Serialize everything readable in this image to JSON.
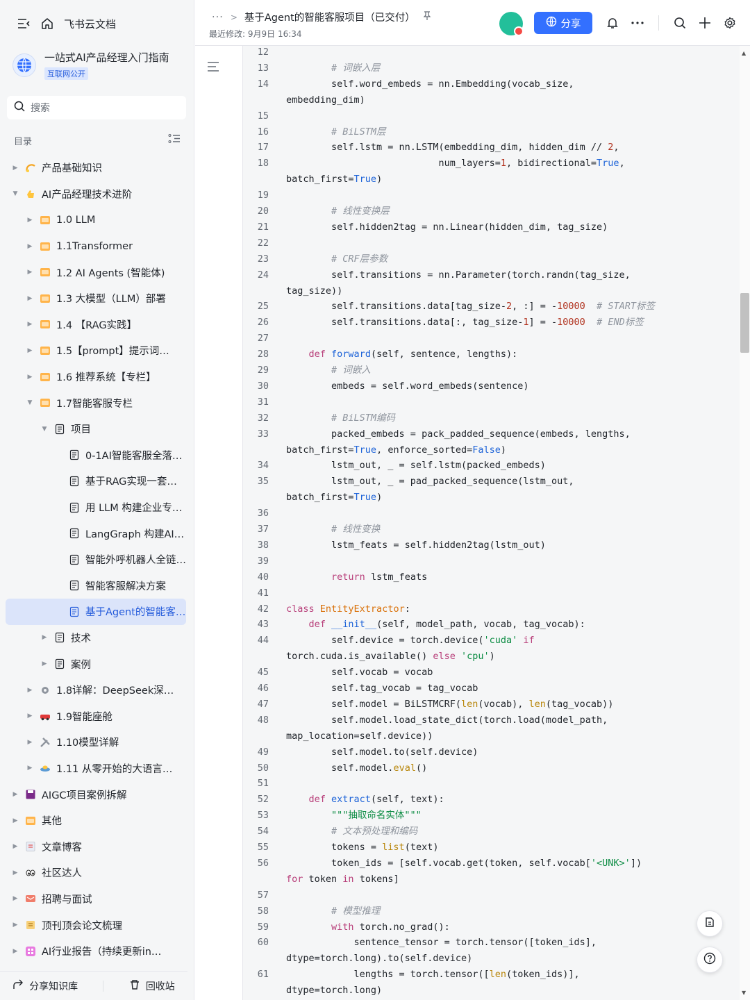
{
  "sidebar": {
    "home_label": "飞书云文档",
    "space_title": "一站式AI产品经理入门指南",
    "space_badge": "互联网公开",
    "search_placeholder": "搜索",
    "toc_label": "目录",
    "tree": [
      {
        "label": "产品基础知识",
        "level": 0,
        "caret": "right",
        "icon": "sun-icon"
      },
      {
        "label": "AI产品经理技术进阶",
        "level": 0,
        "caret": "down",
        "icon": "hand-icon"
      },
      {
        "label": "1.0 LLM",
        "level": 1,
        "caret": "right",
        "icon": "folder-orange-icon"
      },
      {
        "label": "1.1Transformer",
        "level": 1,
        "caret": "right",
        "icon": "folder-orange-icon"
      },
      {
        "label": "1.2 AI Agents (智能体)",
        "level": 1,
        "caret": "right",
        "icon": "folder-orange-icon"
      },
      {
        "label": "1.3 大模型（LLM）部署",
        "level": 1,
        "caret": "right",
        "icon": "folder-orange-icon"
      },
      {
        "label": "1.4 【RAG实践】",
        "level": 1,
        "caret": "right",
        "icon": "folder-orange-icon"
      },
      {
        "label": "1.5【prompt】提示词工程",
        "level": 1,
        "caret": "right",
        "icon": "folder-orange-icon"
      },
      {
        "label": "1.6 推荐系统【专栏】",
        "level": 1,
        "caret": "right",
        "icon": "folder-orange-icon"
      },
      {
        "label": "1.7智能客服专栏",
        "level": 1,
        "caret": "down",
        "icon": "folder-orange-icon"
      },
      {
        "label": "项目",
        "level": 2,
        "caret": "down",
        "icon": "doc-icon"
      },
      {
        "label": "0-1AI智能客服全落地实战",
        "level": 3,
        "caret": "none",
        "icon": "doc-icon"
      },
      {
        "label": "基于RAG实现一套企业级知识库",
        "level": 3,
        "caret": "none",
        "icon": "doc-icon"
      },
      {
        "label": "用 LLM 构建企业专属客服",
        "level": 3,
        "caret": "none",
        "icon": "doc-icon"
      },
      {
        "label": "LangGraph 构建AI客服",
        "level": 3,
        "caret": "none",
        "icon": "doc-icon"
      },
      {
        "label": "智能外呼机器人全链路设计",
        "level": 3,
        "caret": "none",
        "icon": "doc-icon"
      },
      {
        "label": "智能客服解决方案",
        "level": 3,
        "caret": "none",
        "icon": "doc-icon"
      },
      {
        "label": "基于Agent的智能客服项目",
        "level": 3,
        "caret": "none",
        "icon": "doc-icon",
        "active": true
      },
      {
        "label": "技术",
        "level": 2,
        "caret": "right",
        "icon": "doc-icon"
      },
      {
        "label": "案例",
        "level": 2,
        "caret": "right",
        "icon": "doc-icon"
      },
      {
        "label": "1.8详解：DeepSeek深度推理模型",
        "level": 1,
        "caret": "right",
        "icon": "gear-icon"
      },
      {
        "label": "1.9智能座舱",
        "level": 1,
        "caret": "right",
        "icon": "car-icon"
      },
      {
        "label": "1.10模型详解",
        "level": 1,
        "caret": "right",
        "icon": "tools-icon"
      },
      {
        "label": "1.11 从零开始的大语言模型",
        "level": 1,
        "caret": "right",
        "icon": "ufo-icon"
      },
      {
        "label": "AIGC项目案例拆解",
        "level": 0,
        "caret": "right",
        "icon": "floppy-icon"
      },
      {
        "label": "其他",
        "level": 0,
        "caret": "right",
        "icon": "folder-orange-icon"
      },
      {
        "label": "文章博客",
        "level": 0,
        "caret": "right",
        "icon": "note-icon"
      },
      {
        "label": "社区达人",
        "level": 0,
        "caret": "right",
        "icon": "eyes-icon"
      },
      {
        "label": "招聘与面试",
        "level": 0,
        "caret": "right",
        "icon": "mail-icon"
      },
      {
        "label": "顶刊顶会论文梳理",
        "level": 0,
        "caret": "right",
        "icon": "scroll-icon"
      },
      {
        "label": "AI行业报告（持续更新ing）",
        "level": 0,
        "caret": "right",
        "icon": "grid-icon"
      }
    ],
    "footer_share": "分享知识库",
    "footer_trash": "回收站"
  },
  "header": {
    "breadcrumb_more": "···",
    "title": "基于Agent的智能客服项目（已交付）",
    "modified": "最近修改: 9月9日 16:34",
    "share_label": "分享"
  },
  "code": [
    {
      "n": "12",
      "t": ""
    },
    {
      "n": "13",
      "t": "        # 词嵌入层"
    },
    {
      "n": "14",
      "t": "        self.word_embeds = nn.Embedding(vocab_size,"
    },
    {
      "n": "",
      "t": "embedding_dim)"
    },
    {
      "n": "15",
      "t": ""
    },
    {
      "n": "16",
      "t": "        # BiLSTM层"
    },
    {
      "n": "17",
      "t": "        self.lstm = nn.LSTM(embedding_dim, hidden_dim // 2,"
    },
    {
      "n": "18",
      "t": "                           num_layers=1, bidirectional=True,"
    },
    {
      "n": "",
      "t": "batch_first=True)"
    },
    {
      "n": "19",
      "t": ""
    },
    {
      "n": "20",
      "t": "        # 线性变换层"
    },
    {
      "n": "21",
      "t": "        self.hidden2tag = nn.Linear(hidden_dim, tag_size)"
    },
    {
      "n": "22",
      "t": ""
    },
    {
      "n": "23",
      "t": "        # CRF层参数"
    },
    {
      "n": "24",
      "t": "        self.transitions = nn.Parameter(torch.randn(tag_size,"
    },
    {
      "n": "",
      "t": "tag_size))"
    },
    {
      "n": "25",
      "t": "        self.transitions.data[tag_size-2, :] = -10000  # START标签"
    },
    {
      "n": "26",
      "t": "        self.transitions.data[:, tag_size-1] = -10000  # END标签"
    },
    {
      "n": "27",
      "t": ""
    },
    {
      "n": "28",
      "t": "    def forward(self, sentence, lengths):"
    },
    {
      "n": "29",
      "t": "        # 词嵌入"
    },
    {
      "n": "30",
      "t": "        embeds = self.word_embeds(sentence)"
    },
    {
      "n": "31",
      "t": ""
    },
    {
      "n": "32",
      "t": "        # BiLSTM编码"
    },
    {
      "n": "33",
      "t": "        packed_embeds = pack_padded_sequence(embeds, lengths,"
    },
    {
      "n": "",
      "t": "batch_first=True, enforce_sorted=False)"
    },
    {
      "n": "34",
      "t": "        lstm_out, _ = self.lstm(packed_embeds)"
    },
    {
      "n": "35",
      "t": "        lstm_out, _ = pad_packed_sequence(lstm_out,"
    },
    {
      "n": "",
      "t": "batch_first=True)"
    },
    {
      "n": "36",
      "t": ""
    },
    {
      "n": "37",
      "t": "        # 线性变换"
    },
    {
      "n": "38",
      "t": "        lstm_feats = self.hidden2tag(lstm_out)"
    },
    {
      "n": "39",
      "t": ""
    },
    {
      "n": "40",
      "t": "        return lstm_feats"
    },
    {
      "n": "41",
      "t": ""
    },
    {
      "n": "42",
      "t": "class EntityExtractor:"
    },
    {
      "n": "43",
      "t": "    def __init__(self, model_path, vocab, tag_vocab):"
    },
    {
      "n": "44",
      "t": "        self.device = torch.device('cuda' if"
    },
    {
      "n": "",
      "t": "torch.cuda.is_available() else 'cpu')"
    },
    {
      "n": "45",
      "t": "        self.vocab = vocab"
    },
    {
      "n": "46",
      "t": "        self.tag_vocab = tag_vocab"
    },
    {
      "n": "47",
      "t": "        self.model = BiLSTMCRF(len(vocab), len(tag_vocab))"
    },
    {
      "n": "48",
      "t": "        self.model.load_state_dict(torch.load(model_path,"
    },
    {
      "n": "",
      "t": "map_location=self.device))"
    },
    {
      "n": "49",
      "t": "        self.model.to(self.device)"
    },
    {
      "n": "50",
      "t": "        self.model.eval()"
    },
    {
      "n": "51",
      "t": ""
    },
    {
      "n": "52",
      "t": "    def extract(self, text):"
    },
    {
      "n": "53",
      "t": "        \"\"\"抽取命名实体\"\"\""
    },
    {
      "n": "54",
      "t": "        # 文本预处理和编码"
    },
    {
      "n": "55",
      "t": "        tokens = list(text)"
    },
    {
      "n": "56",
      "t": "        token_ids = [self.vocab.get(token, self.vocab['<UNK>'])"
    },
    {
      "n": "",
      "t": "for token in tokens]"
    },
    {
      "n": "57",
      "t": ""
    },
    {
      "n": "58",
      "t": "        # 模型推理"
    },
    {
      "n": "59",
      "t": "        with torch.no_grad():"
    },
    {
      "n": "60",
      "t": "            sentence_tensor = torch.tensor([token_ids],"
    },
    {
      "n": "",
      "t": "dtype=torch.long).to(self.device)"
    },
    {
      "n": "61",
      "t": "            lengths = torch.tensor([len(token_ids)],"
    },
    {
      "n": "",
      "t": "dtype=torch.long)"
    }
  ]
}
